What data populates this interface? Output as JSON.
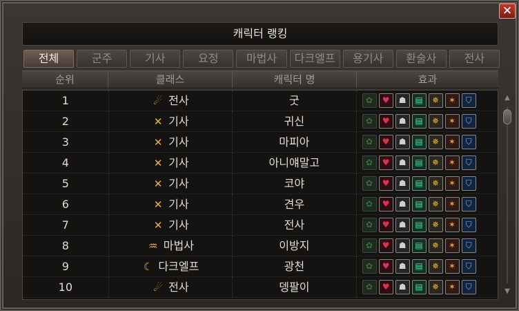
{
  "window": {
    "title": "캐릭터 랭킹",
    "close_label": "✕"
  },
  "tabs": [
    {
      "label": "전체",
      "active": true
    },
    {
      "label": "군주",
      "active": false
    },
    {
      "label": "기사",
      "active": false
    },
    {
      "label": "요정",
      "active": false
    },
    {
      "label": "마법사",
      "active": false
    },
    {
      "label": "다크엘프",
      "active": false
    },
    {
      "label": "용기사",
      "active": false
    },
    {
      "label": "환술사",
      "active": false
    },
    {
      "label": "전사",
      "active": false
    }
  ],
  "table": {
    "headers": {
      "rank": "순위",
      "class": "클래스",
      "name": "캐릭터 명",
      "effect": "효과"
    },
    "rows": [
      {
        "rank": "1",
        "class": "전사",
        "class_icon": "warrior-icon",
        "name": "굿"
      },
      {
        "rank": "2",
        "class": "기사",
        "class_icon": "knight-icon",
        "name": "귀신"
      },
      {
        "rank": "3",
        "class": "기사",
        "class_icon": "knight-icon",
        "name": "마피아"
      },
      {
        "rank": "4",
        "class": "기사",
        "class_icon": "knight-icon",
        "name": "아니얘말고"
      },
      {
        "rank": "5",
        "class": "기사",
        "class_icon": "knight-icon",
        "name": "코야"
      },
      {
        "rank": "6",
        "class": "기사",
        "class_icon": "knight-icon",
        "name": "견우"
      },
      {
        "rank": "7",
        "class": "기사",
        "class_icon": "knight-icon",
        "name": "전사"
      },
      {
        "rank": "8",
        "class": "마법사",
        "class_icon": "wizard-icon",
        "name": "이방지"
      },
      {
        "rank": "9",
        "class": "다크엘프",
        "class_icon": "darkelf-icon",
        "name": "광천"
      },
      {
        "rank": "10",
        "class": "전사",
        "class_icon": "warrior-icon",
        "name": "뎅팔이"
      }
    ],
    "effect_icons": [
      "buff-icon-1",
      "heart-icon",
      "helmet-icon",
      "scroll-icon",
      "skeleton-icon",
      "skull-icon",
      "shield-icon"
    ]
  }
}
